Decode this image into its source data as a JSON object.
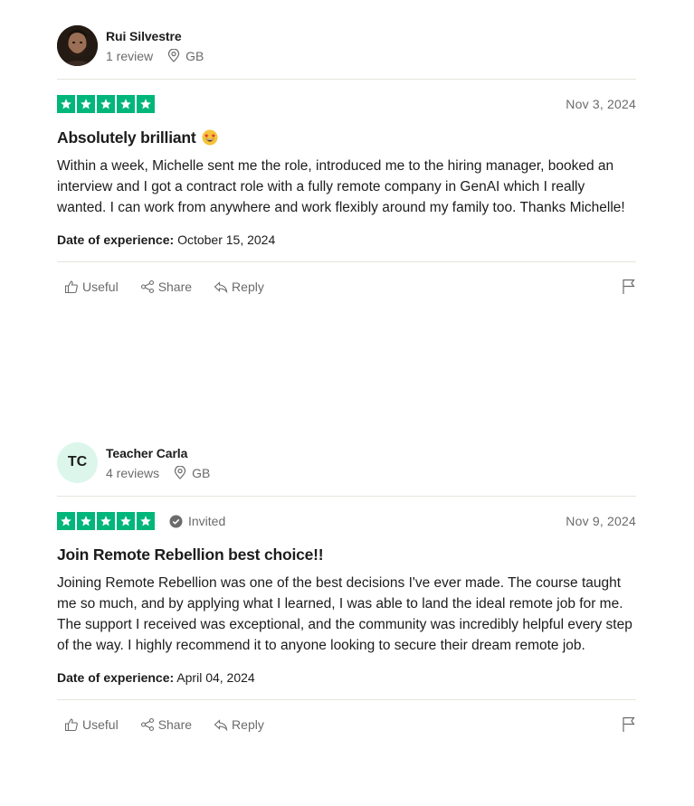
{
  "colors": {
    "star_green": "#00b67a",
    "muted_text": "#6b6b6b",
    "initials_bg": "#dcf6ec"
  },
  "reviews": [
    {
      "avatar": {
        "type": "photo",
        "icon": "person-photo"
      },
      "name": "Rui Silvestre",
      "review_count": "1 review",
      "location": "GB",
      "rating": 5,
      "invited": false,
      "date": "Nov 3, 2024",
      "title": "Absolutely brilliant",
      "title_emoji": "star-struck-emoji-icon",
      "body": "Within a week, Michelle sent me the role, introduced me to the hiring manager, booked an interview and I got a contract role with a fully remote company in GenAI which I really wanted. I can work from anywhere and work flexibly around my family too. Thanks Michelle!",
      "experience_label": "Date of experience:",
      "experience_date": "October 15, 2024",
      "actions": {
        "useful": "Useful",
        "share": "Share",
        "reply": "Reply"
      }
    },
    {
      "avatar": {
        "type": "initials",
        "initials": "TC"
      },
      "name": "Teacher Carla",
      "review_count": "4 reviews",
      "location": "GB",
      "rating": 5,
      "invited": true,
      "invited_label": "Invited",
      "date": "Nov 9, 2024",
      "title": "Join Remote Rebellion best choice!!",
      "body": "Joining Remote Rebellion was one of the best decisions I've ever made. The course taught me so much, and by applying what I learned, I was able to land the ideal remote job for me. The support I received was exceptional, and the community was incredibly helpful every step of the way. I highly recommend it to anyone looking to secure their dream remote job.",
      "experience_label": "Date of experience:",
      "experience_date": "April 04, 2024",
      "actions": {
        "useful": "Useful",
        "share": "Share",
        "reply": "Reply"
      }
    }
  ]
}
